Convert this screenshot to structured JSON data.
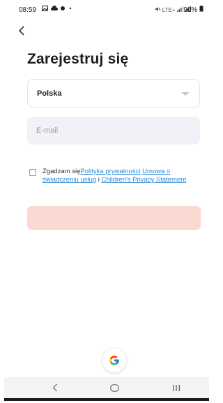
{
  "status_bar": {
    "time": "08:59",
    "left_icons": [
      "image-icon",
      "cloud-icon",
      "record-icon",
      "dot-icon"
    ],
    "right_text": "LTE+",
    "battery": "90%"
  },
  "page": {
    "title": "Zarejestruj się"
  },
  "country_select": {
    "value": "Polska"
  },
  "email": {
    "placeholder": "E-mail",
    "value": ""
  },
  "consent": {
    "checked": false,
    "prefix": "Zgadzam się",
    "privacy_link": "Polityka prywatności",
    "terms_link": "Umowa o świadczeniu usług",
    "connector": " i ",
    "children_link": "Children's Privacy Statement"
  },
  "register_button": {
    "label": "",
    "disabled": true,
    "color": "#fcd6d1"
  },
  "social": {
    "google_icon": "google-icon"
  },
  "nav_bar": {
    "icons": [
      "back-nav-icon",
      "home-nav-icon",
      "recents-nav-icon"
    ]
  },
  "colors": {
    "link": "#2b8ad8",
    "input_bg": "#f1f2f7",
    "button_disabled": "#fcd6d1"
  }
}
